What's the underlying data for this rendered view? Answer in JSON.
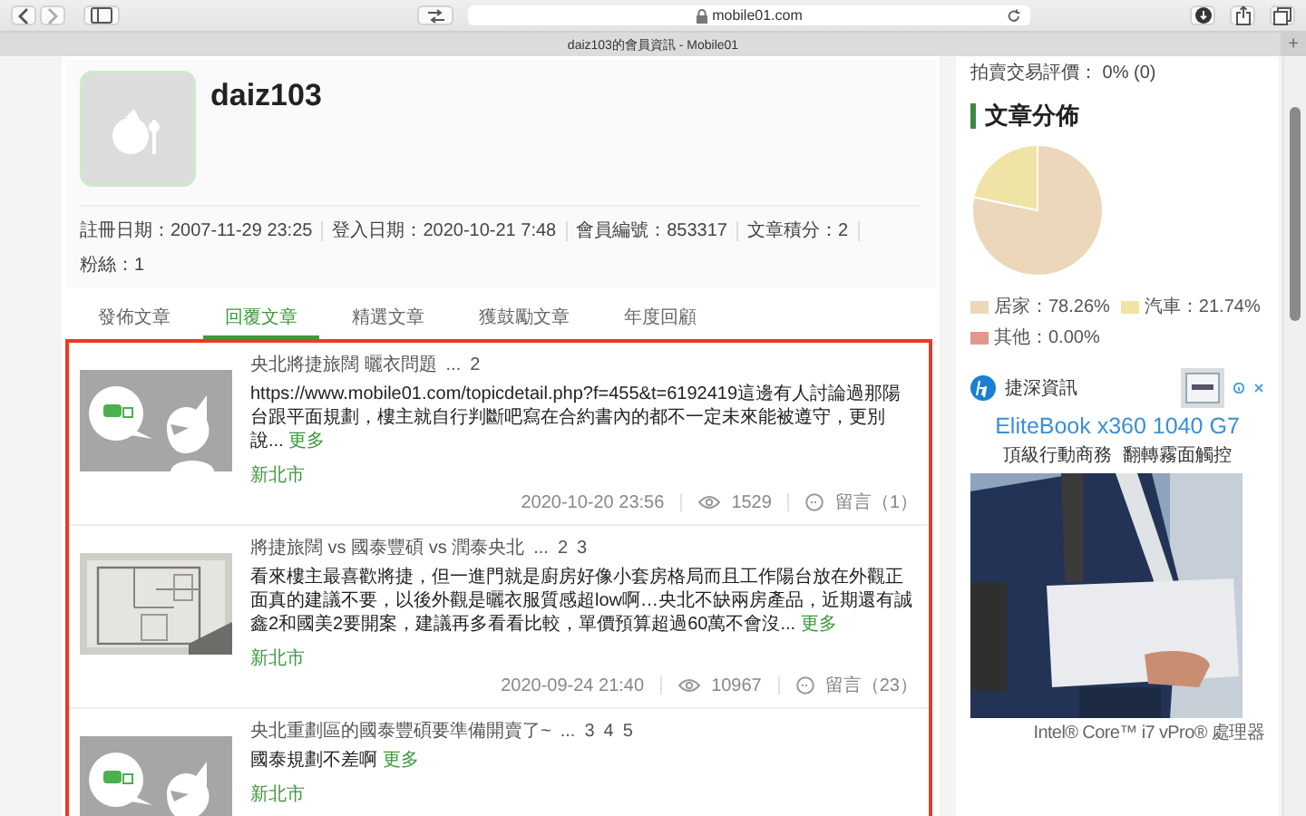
{
  "browser": {
    "url": "mobile01.com",
    "tab_title": "daiz103的會員資訊 - Mobile01",
    "new_tab": "+"
  },
  "profile": {
    "username": "daiz103",
    "info": [
      "註冊日期：2007-11-29 23:25",
      "登入日期：2020-10-21 7:48",
      "會員編號：853317",
      "文章積分：2",
      "粉絲：1"
    ]
  },
  "tabs": [
    {
      "label": "發佈文章",
      "selected": false
    },
    {
      "label": "回覆文章",
      "selected": true
    },
    {
      "label": "精選文章",
      "selected": false
    },
    {
      "label": "獲鼓勵文章",
      "selected": false
    },
    {
      "label": "年度回顧",
      "selected": false
    }
  ],
  "posts": [
    {
      "kind": "placeholder",
      "title": "央北將捷旅闊 曬衣問題",
      "ellipsis": "...",
      "pages": [
        "2"
      ],
      "body": "https://www.mobile01.com/topicdetail.php?f=455&t=6192419這邊有人討論過那陽台跟平面規劃，樓主就自行判斷吧寫在合約書內的都不一定未來能被遵守，更別說...",
      "more": "更多",
      "region": "新北市",
      "date": "2020-10-20 23:56",
      "views": "1529",
      "comments": "留言（1）"
    },
    {
      "kind": "picture",
      "title": "將捷旅闊 vs 國泰豐碩 vs 潤泰央北",
      "ellipsis": "...",
      "pages": [
        "2",
        "3"
      ],
      "body": "看來樓主最喜歡將捷，但一進門就是廚房好像小套房格局而且工作陽台放在外觀正面真的建議不要，以後外觀是曬衣服質感超low啊…央北不缺兩房產品，近期還有誠鑫2和國美2要開案，建議再多看看比較，單價預算超過60萬不會沒...",
      "more": "更多",
      "region": "新北市",
      "date": "2020-09-24 21:40",
      "views": "10967",
      "comments": "留言（23）"
    },
    {
      "kind": "placeholder",
      "title": "央北重劃區的國泰豐碩要準備開賣了~",
      "ellipsis": "...",
      "pages": [
        "3",
        "4",
        "5"
      ],
      "body": "國泰規劃不差啊",
      "more": "更多",
      "region": "新北市"
    }
  ],
  "sidebar": {
    "rating": "拍賣交易評價： 0% (0)",
    "heading": "文章分佈",
    "chart_data": {
      "type": "pie",
      "categories": [
        "居家",
        "汽車",
        "其他"
      ],
      "values": [
        78.26,
        21.74,
        0
      ],
      "value_labels": [
        "：78.26%",
        "：21.74%",
        "：0.00%"
      ]
    },
    "legend": [
      {
        "color": "#ecd7bb"
      },
      {
        "color": "#efe4a6"
      },
      {
        "color": "#e3968a"
      }
    ]
  },
  "ad": {
    "brand": "捷深資訊",
    "headline": "EliteBook x360 1040 G7",
    "tagline": "頂級行動商務  翻轉霧面觸控",
    "caption": "Intel® Core™ i7 vPro® 處理器"
  }
}
